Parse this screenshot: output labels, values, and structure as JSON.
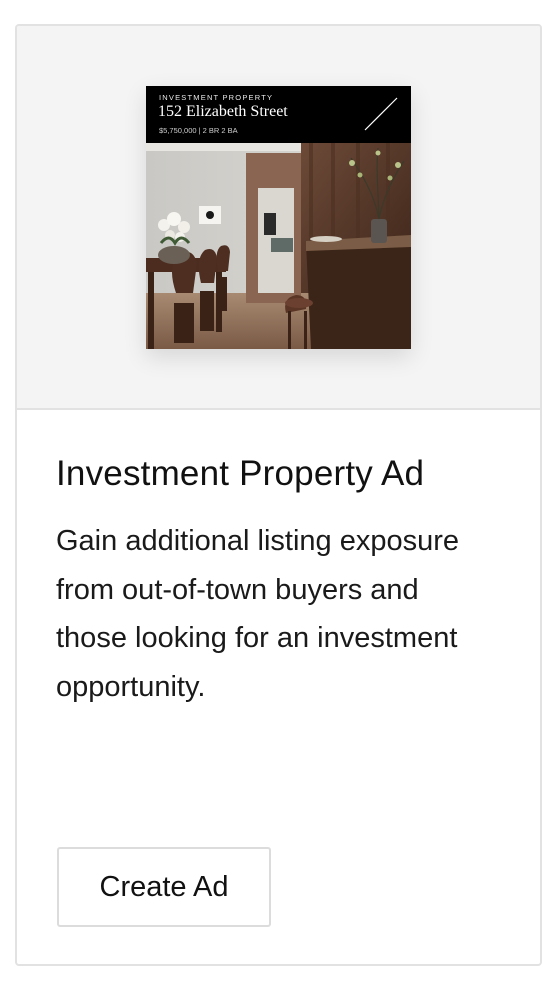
{
  "ad_preview": {
    "eyebrow": "INVESTMENT PROPERTY",
    "address": "152 Elizabeth Street",
    "meta": "$5,750,000 | 2 BR 2 BA"
  },
  "card": {
    "title": "Investment Property Ad",
    "description": "Gain additional listing exposure from out-of-town buyers and those looking for an investment opportunity.",
    "button_label": "Create Ad"
  }
}
